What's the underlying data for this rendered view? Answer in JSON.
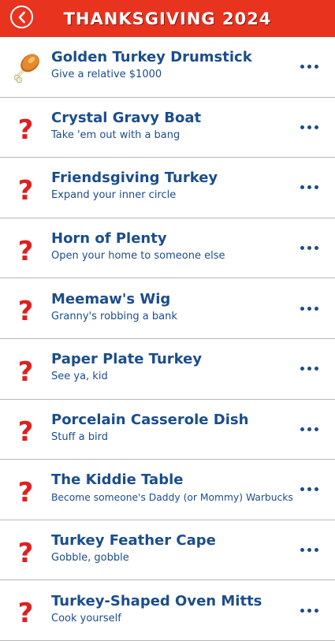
{
  "header": {
    "title": "THANKSGIVING 2024"
  },
  "colors": {
    "header_bg": "#e8331f",
    "text_blue": "#1b4d8c",
    "question_red": "#e01f1f"
  },
  "items": [
    {
      "title": "Golden Turkey Drumstick",
      "subtitle": "Give a relative $1000",
      "icon": "drumstick-icon"
    },
    {
      "title": "Crystal Gravy Boat",
      "subtitle": "Take 'em out with a bang",
      "icon": "question-mark-icon"
    },
    {
      "title": "Friendsgiving Turkey",
      "subtitle": "Expand your inner circle",
      "icon": "question-mark-icon"
    },
    {
      "title": "Horn of Plenty",
      "subtitle": "Open your home to someone else",
      "icon": "question-mark-icon"
    },
    {
      "title": "Meemaw's Wig",
      "subtitle": "Granny's robbing a bank",
      "icon": "question-mark-icon"
    },
    {
      "title": "Paper Plate Turkey",
      "subtitle": "See ya, kid",
      "icon": "question-mark-icon"
    },
    {
      "title": "Porcelain Casserole Dish",
      "subtitle": "Stuff a bird",
      "icon": "question-mark-icon"
    },
    {
      "title": "The Kiddie Table",
      "subtitle": "Become someone's Daddy (or Mommy) Warbucks",
      "icon": "question-mark-icon"
    },
    {
      "title": "Turkey Feather Cape",
      "subtitle": "Gobble, gobble",
      "icon": "question-mark-icon"
    },
    {
      "title": "Turkey-Shaped Oven Mitts",
      "subtitle": "Cook yourself",
      "icon": "question-mark-icon"
    }
  ]
}
